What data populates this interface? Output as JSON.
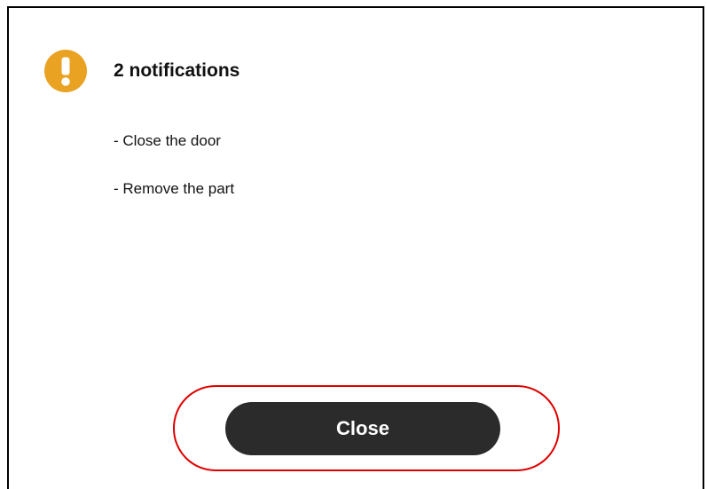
{
  "dialog": {
    "title": "2 notifications",
    "icon": "exclamation-warning-icon",
    "messages": [
      "- Close the door",
      "- Remove the part"
    ],
    "close_label": "Close"
  },
  "colors": {
    "warning": "#EAA223",
    "button_bg": "#2B2B2B",
    "button_text": "#FFFFFF",
    "highlight": "#E00000"
  }
}
